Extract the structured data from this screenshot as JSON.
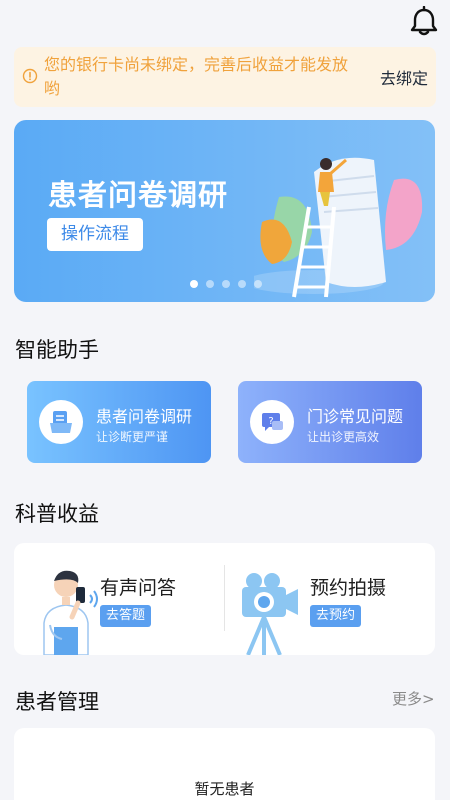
{
  "notice": {
    "text": "您的银行卡尚未绑定，完善后收益才能发放哟",
    "action": "去绑定"
  },
  "banner": {
    "title": "患者问卷调研",
    "button": "操作流程",
    "slide_count": 5,
    "active_slide": 1
  },
  "assistant": {
    "section_title": "智能助手",
    "cards": [
      {
        "title": "患者问卷调研",
        "subtitle": "让诊断更严谨",
        "icon": "survey-icon"
      },
      {
        "title": "门诊常见问题",
        "subtitle": "让出诊更高效",
        "icon": "faq-icon"
      }
    ]
  },
  "earnings": {
    "section_title": "科普收益",
    "items": [
      {
        "title": "有声问答",
        "action": "去答题",
        "icon": "doctor-phone-illustration"
      },
      {
        "title": "预约拍摄",
        "action": "去预约",
        "icon": "camera-tripod-illustration"
      }
    ]
  },
  "patients": {
    "section_title": "患者管理",
    "more": "更多>",
    "empty": "暂无患者"
  },
  "colors": {
    "accent": "#3d8ae8",
    "notice_text": "#f0a23c",
    "notice_bg": "#fdf3e3",
    "page_bg": "#f4f5f9"
  }
}
